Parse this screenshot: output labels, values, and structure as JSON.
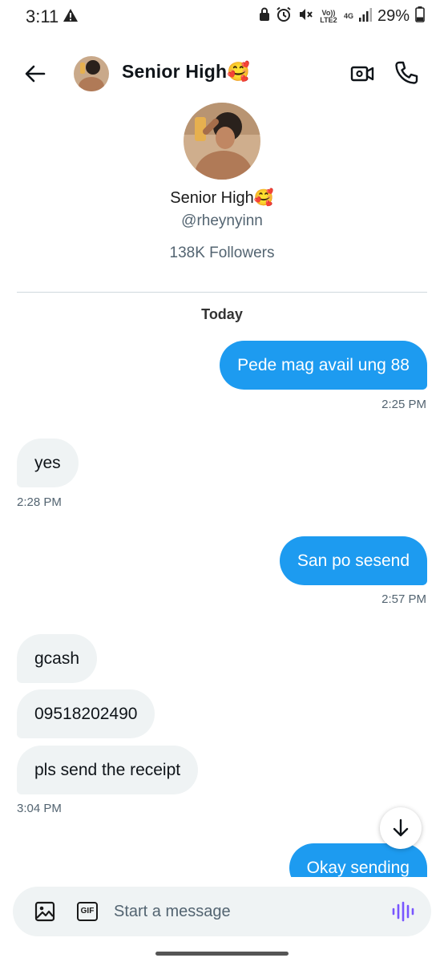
{
  "status_bar": {
    "time": "3:11",
    "battery": "29%",
    "volte_label": "Vo)) LTE2",
    "network_label": "4G",
    "icons": [
      "warning-icon",
      "lock-icon",
      "alarm-icon",
      "mute-icon",
      "signal-icon",
      "battery-icon"
    ]
  },
  "header": {
    "title": "Senior High🥰",
    "icons": [
      "back-arrow-icon",
      "video-call-icon",
      "phone-icon"
    ]
  },
  "profile": {
    "name": "Senior High🥰",
    "handle": "@rheynyinn",
    "followers": "138K Followers"
  },
  "conversation": {
    "day_label": "Today",
    "messages": [
      {
        "direction": "out",
        "text": "Pede mag avail ung 88",
        "time": "2:25 PM"
      },
      {
        "direction": "in",
        "text": "yes",
        "time": "2:28 PM"
      },
      {
        "direction": "out",
        "text": "San po sesend",
        "time": "2:57 PM"
      },
      {
        "direction": "in",
        "text": "gcash",
        "time": ""
      },
      {
        "direction": "in",
        "text": "09518202490",
        "time": ""
      },
      {
        "direction": "in",
        "text": "pls send the receipt",
        "time": "3:04 PM"
      },
      {
        "direction": "out",
        "text": "Okay sending",
        "time": ""
      }
    ]
  },
  "composer": {
    "placeholder": "Start a message",
    "gif_label": "GIF"
  },
  "colors": {
    "accent": "#1d9bf0",
    "incoming_bubble": "#eff3f4",
    "secondary_text": "#536471",
    "voice_icon": "#7856ff"
  }
}
